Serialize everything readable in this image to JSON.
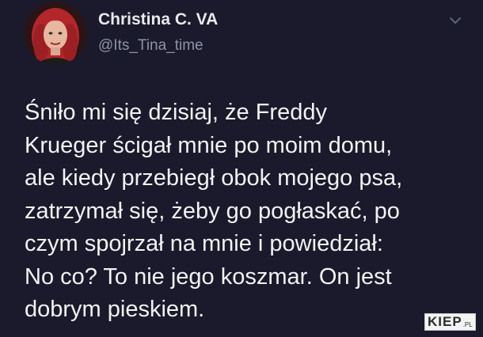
{
  "author": {
    "display_name": "Christina C. VA",
    "handle": "@Its_Tina_time",
    "avatar_icon": "profile-photo"
  },
  "tweet": {
    "text_lines": [
      "Śniło mi się dzisiaj, że Freddy",
      "Krueger ścigał mnie po moim domu,",
      "ale kiedy przebiegł obok mojego psa,",
      "zatrzymał się, żeby go pogłaskać, po",
      "czym spojrzał na mnie i powiedział:",
      "No co? To nie jego koszmar. On jest",
      "dobrym pieskiem."
    ]
  },
  "menu": {
    "icon": "chevron-down-icon"
  },
  "watermark": {
    "main": "KIEP",
    "sub": ".PL"
  },
  "colors": {
    "background": "#1a1a2c",
    "text": "#f2f2f4",
    "handle": "#8d93a5"
  }
}
